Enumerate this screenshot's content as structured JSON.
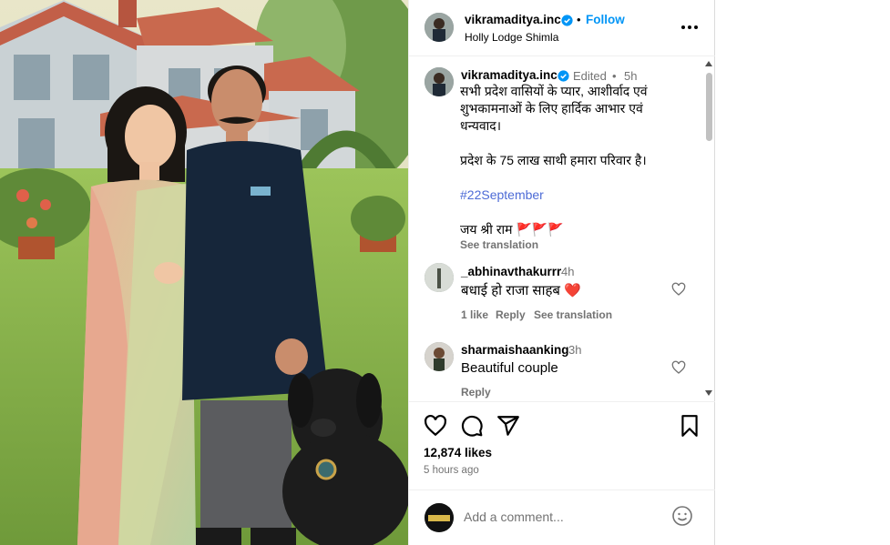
{
  "post_image": {
    "description_icon": "photo-icon"
  },
  "header": {
    "username": "vikramaditya.inc",
    "follow_label": "Follow",
    "location": "Holly Lodge Shimla",
    "separator": "•"
  },
  "caption": {
    "username": "vikramaditya.inc",
    "edited": "Edited",
    "separator": "•",
    "time": "5h",
    "lines": [
      "सभी प्रदेश वासियों के प्यार, आशीर्वाद एवं शुभकामनाओं के लिए हार्दिक आभार एवं धन्यवाद।",
      "प्रदेश के 75 लाख साथी हमारा परिवार है।",
      "#22September",
      "जय श्री राम 🚩🚩🚩"
    ],
    "see_translation": "See translation"
  },
  "comments": [
    {
      "username": "_abhinavthakurrr",
      "time": "4h",
      "text": "बधाई हो राजा साहब ❤️",
      "likes": "1 like",
      "reply": "Reply",
      "see_translation": "See translation"
    },
    {
      "username": "sharmaishaanking",
      "time": "3h",
      "text": "Beautiful couple",
      "reply": "Reply"
    }
  ],
  "actions": {
    "like_icon": "heart-icon",
    "comment_icon": "comment-icon",
    "share_icon": "share-icon",
    "save_icon": "bookmark-icon",
    "likes": "12,874 likes",
    "time_ago": "5 hours ago"
  },
  "add_comment": {
    "placeholder": "Add a comment...",
    "emoji_icon": "emoji-icon"
  },
  "colors": {
    "link": "#0095f6",
    "hashtag": "#4d6bd6",
    "muted": "#737373",
    "verified": "#0095f6"
  }
}
